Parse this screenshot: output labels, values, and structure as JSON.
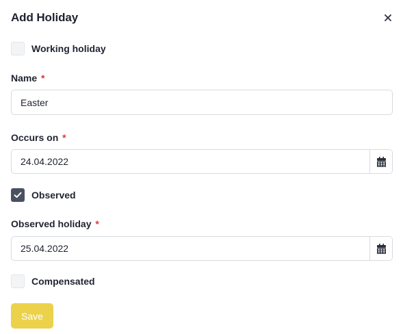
{
  "dialog": {
    "title": "Add Holiday",
    "close_icon": "close-icon"
  },
  "working_holiday": {
    "label": "Working holiday",
    "checked": false
  },
  "name": {
    "label": "Name",
    "required_marker": "*",
    "value": "Easter"
  },
  "occurs_on": {
    "label": "Occurs on",
    "required_marker": "*",
    "value": "24.04.2022",
    "icon": "calendar-icon"
  },
  "observed": {
    "label": "Observed",
    "checked": true
  },
  "observed_holiday": {
    "label": "Observed holiday",
    "required_marker": "*",
    "value": "25.04.2022",
    "icon": "calendar-icon"
  },
  "compensated": {
    "label": "Compensated",
    "checked": false
  },
  "actions": {
    "save_label": "Save"
  },
  "colors": {
    "text": "#1f2330",
    "required": "#d63a3a",
    "checkbox_checked": "#4a5261",
    "checkbox_unchecked": "#f3f4f6",
    "border": "#d7dae0",
    "save_button": "#ebd24a"
  }
}
